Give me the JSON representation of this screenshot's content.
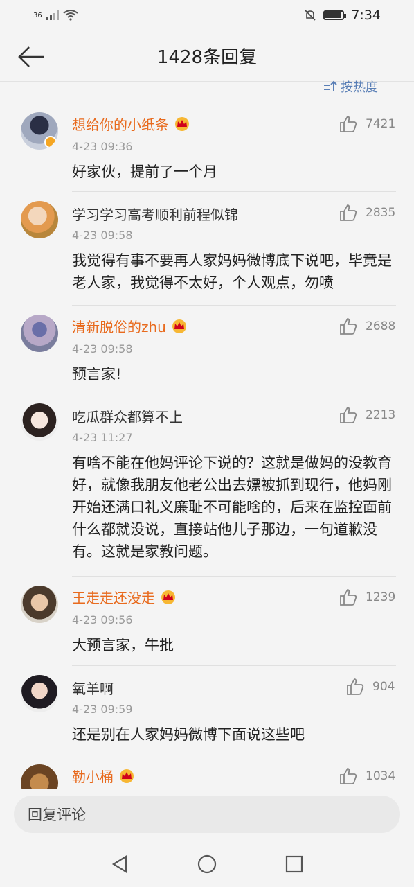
{
  "status_bar": {
    "signal": "36",
    "time": "7:34"
  },
  "header": {
    "title": "1428条回复"
  },
  "sort": {
    "label": "按热度"
  },
  "comments": [
    {
      "name": "想给你的小纸条",
      "vip": true,
      "time": "4-23 09:36",
      "likes": "7421",
      "text": "好家伙，提前了一个月"
    },
    {
      "name": "学习学习高考顺利前程似锦",
      "vip": false,
      "time": "4-23 09:58",
      "likes": "2835",
      "text": "我觉得有事不要再人家妈妈微博底下说吧，毕竟是老人家，我觉得不太好，个人观点，勿喷"
    },
    {
      "name": "清新脱俗的zhu",
      "vip": true,
      "time": "4-23 09:58",
      "likes": "2688",
      "text": "预言家!"
    },
    {
      "name": "吃瓜群众都算不上",
      "vip": false,
      "time": "4-23 11:27",
      "likes": "2213",
      "text": "有啥不能在他妈评论下说的？这就是做妈的没教育好，就像我朋友他老公出去嫖被抓到现行，他妈刚开始还满口礼义廉耻不可能啥的，后来在监控面前什么都就没说，直接站他儿子那边，一句道歉没有。这就是家教问题。"
    },
    {
      "name": "王走走还没走",
      "vip": true,
      "time": "4-23 09:56",
      "likes": "1239",
      "text": "大预言家，牛批"
    },
    {
      "name": "氧羊啊",
      "vip": false,
      "time": "4-23 09:59",
      "likes": "904",
      "text": "还是别在人家妈妈微博下面说这些吧"
    },
    {
      "name": "勒小桶",
      "vip": true,
      "time": "",
      "likes": "1034",
      "text": ""
    }
  ],
  "reply": {
    "placeholder": "回复评论"
  },
  "colors": {
    "vip_name": "#e86a1d",
    "sort_link": "#5a7fb6"
  }
}
